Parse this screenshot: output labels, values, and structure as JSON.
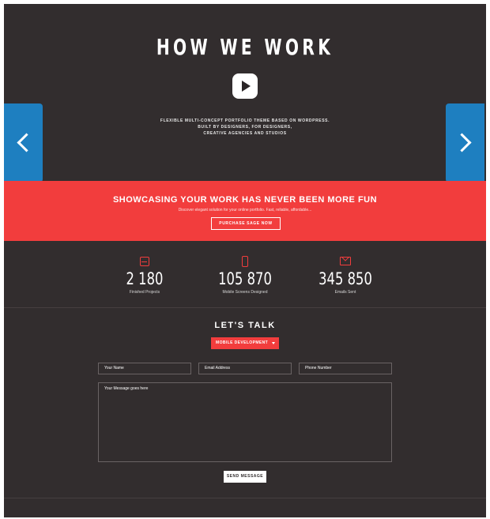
{
  "hero": {
    "title": "HOW WE WORK",
    "tagline_line1": "FLEXIBLE MULTI-CONCEPT PORTFOLIO THEME  BASED ON WORDPRESS.",
    "tagline_line2": "BUILT BY DESIGNERS, FOR DESIGNERS,",
    "tagline_line3": "CREATIVE AGENCIES AND STUDIOS"
  },
  "banner": {
    "title": "SHOWCASING YOUR WORK HAS NEVER BEEN MORE FUN",
    "subtitle": "Discover elegant solution for your online portfolio. Fast, reliable, affordable...",
    "button_label": "PURCHASE SAGE NOW"
  },
  "stats": [
    {
      "number": "2 180",
      "label": "Finished Projects",
      "icon": "inbox-icon"
    },
    {
      "number": "105 870",
      "label": "Mobile Screens Designed",
      "icon": "mobile-icon"
    },
    {
      "number": "345 850",
      "label": "Emails Sent",
      "icon": "mail-icon"
    }
  ],
  "contact": {
    "title": "LET'S TALK",
    "select_value": "MOBILE DEVELOPMENT",
    "name_placeholder": "Your Name",
    "email_placeholder": "Email Address",
    "phone_placeholder": "Phone Number",
    "message_placeholder": "Your Message goes here",
    "send_label": "SEND MESSAGE"
  },
  "colors": {
    "background": "#322d2e",
    "accent_red": "#f23d3d",
    "arrow_blue": "#1e7fc0"
  }
}
